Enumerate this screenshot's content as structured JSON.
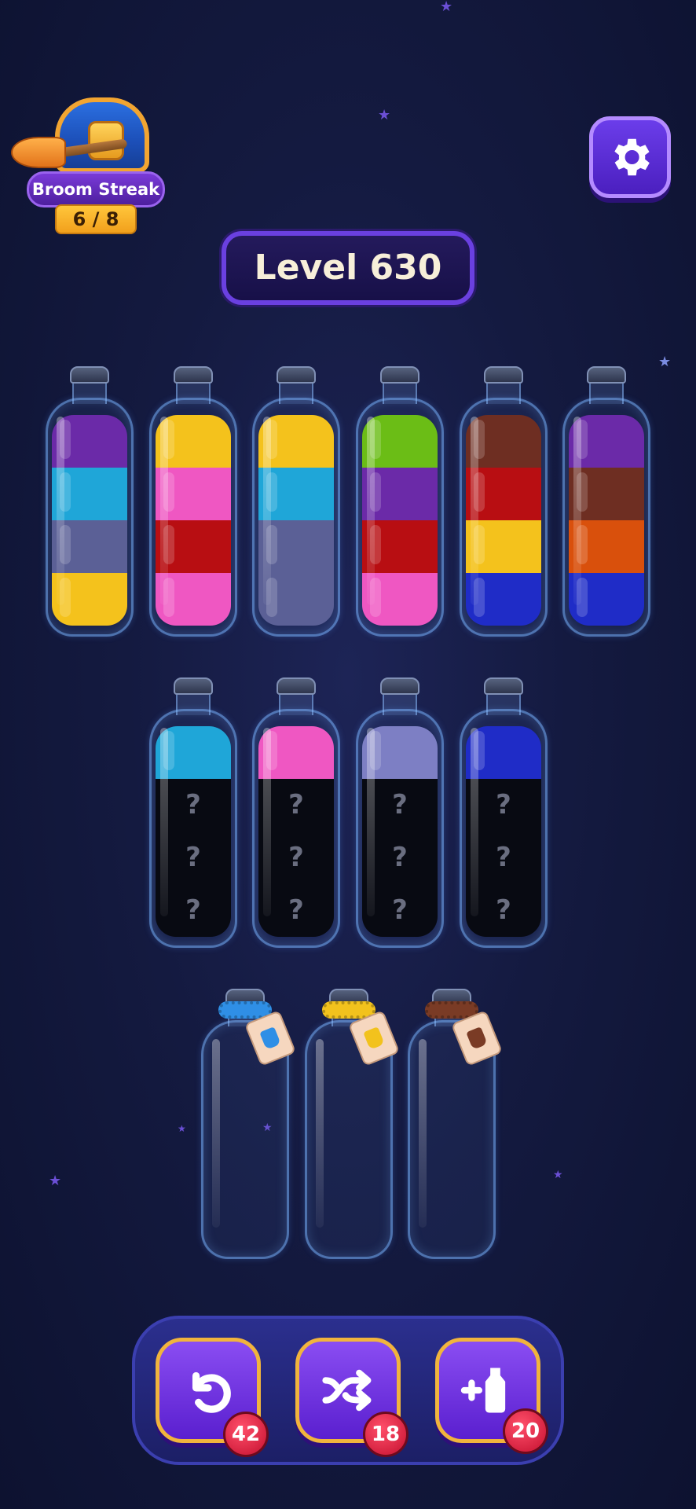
{
  "streak": {
    "label": "Broom Streak",
    "count": "6 / 8"
  },
  "level": {
    "label": "Level 630"
  },
  "colors": {
    "purple": "#6b2aa8",
    "cyan": "#1fa6d8",
    "slate": "#5b6096",
    "yellow": "#f4c21c",
    "pink": "#ef57c2",
    "red": "#b80e12",
    "green": "#6bbd16",
    "brown": "#6e2e22",
    "blue": "#1f2cc7",
    "orange": "#d9500c",
    "lavender": "#7d7fc4"
  },
  "bottles_row1": [
    {
      "layers": [
        "purple",
        "cyan",
        "slate",
        "yellow"
      ]
    },
    {
      "layers": [
        "yellow",
        "pink",
        "red",
        "pink"
      ]
    },
    {
      "layers": [
        "yellow",
        "cyan",
        "slate",
        "slate"
      ]
    },
    {
      "layers": [
        "green",
        "purple",
        "red",
        "pink"
      ]
    },
    {
      "layers": [
        "brown",
        "red",
        "yellow",
        "blue"
      ]
    },
    {
      "layers": [
        "purple",
        "brown",
        "orange",
        "blue"
      ]
    }
  ],
  "bottles_row2": [
    {
      "top": "cyan",
      "hidden": [
        "?",
        "?",
        "?"
      ]
    },
    {
      "top": "pink",
      "hidden": [
        "?",
        "?",
        "?"
      ]
    },
    {
      "top": "lavender",
      "hidden": [
        "?",
        "?",
        "?"
      ]
    },
    {
      "top": "blue",
      "hidden": [
        "?",
        "?",
        "?"
      ]
    }
  ],
  "locked_bottles": [
    {
      "rope_color": "#2f8fe6",
      "potion_color": "#2f8fe6"
    },
    {
      "rope_color": "#f2c21d",
      "potion_color": "#f2c21d"
    },
    {
      "rope_color": "#7a3b25",
      "potion_color": "#7a3b25"
    }
  ],
  "toolbar": {
    "undo": {
      "icon": "undo-icon",
      "count": "42"
    },
    "shuffle": {
      "icon": "shuffle-icon",
      "count": "18"
    },
    "add_bottle": {
      "icon": "add-bottle-icon",
      "count": "20"
    }
  }
}
